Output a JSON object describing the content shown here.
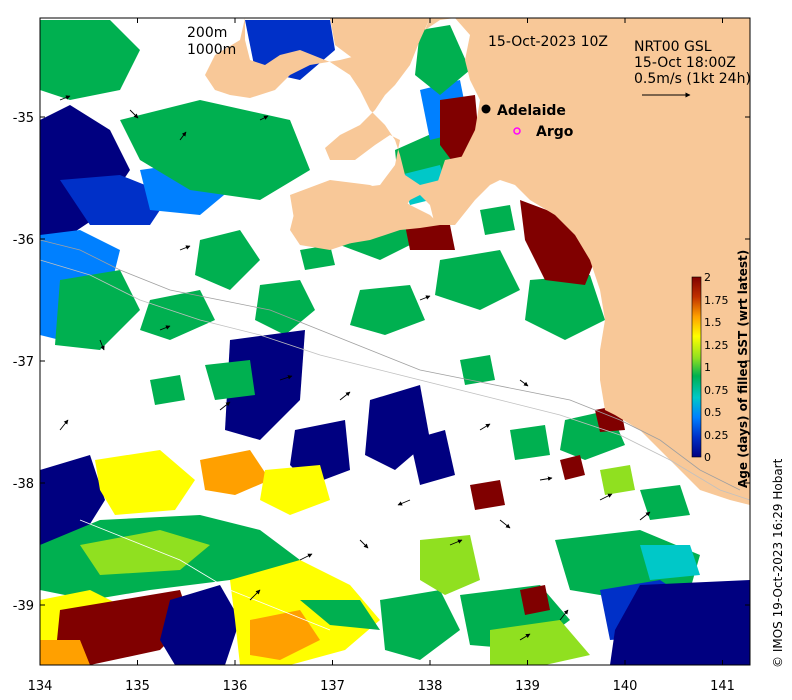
{
  "map": {
    "date_label": "15-Oct-2023 10Z",
    "contours": [
      "200m",
      "1000m"
    ],
    "product": "NRT00 GSL",
    "current_time": "15-Oct 18:00Z",
    "current_scale": "0.5m/s (1kt 24h)",
    "lon_ticks": [
      "134",
      "135",
      "136",
      "137",
      "138",
      "139",
      "140",
      "141"
    ],
    "lat_ticks": [
      "-35",
      "-36",
      "-37",
      "-38",
      "-39"
    ],
    "places": [
      {
        "name": "Adelaide",
        "lon": 138.6,
        "lat": -34.93,
        "marker": "dot",
        "color": "#000000"
      },
      {
        "name": "Argo",
        "lon": 138.85,
        "lat": -35.12,
        "marker": "ring",
        "color": "#ff00ff"
      }
    ],
    "land_color": "#f8c898"
  },
  "colorbar": {
    "title": "Age (days) of filled SST (wrt latest)",
    "ticks": [
      "0",
      "0.25",
      "0.5",
      "0.75",
      "1",
      "1.25",
      "1.5",
      "1.75",
      "2"
    ],
    "range": [
      0,
      2
    ],
    "colors": [
      "#000080",
      "#0030c8",
      "#0080ff",
      "#00c8c8",
      "#00b050",
      "#90e020",
      "#ffff00",
      "#ffa000",
      "#c03000",
      "#800000"
    ]
  },
  "credit": "© IMOS 19-Oct-2023 16:29 Hobart"
}
